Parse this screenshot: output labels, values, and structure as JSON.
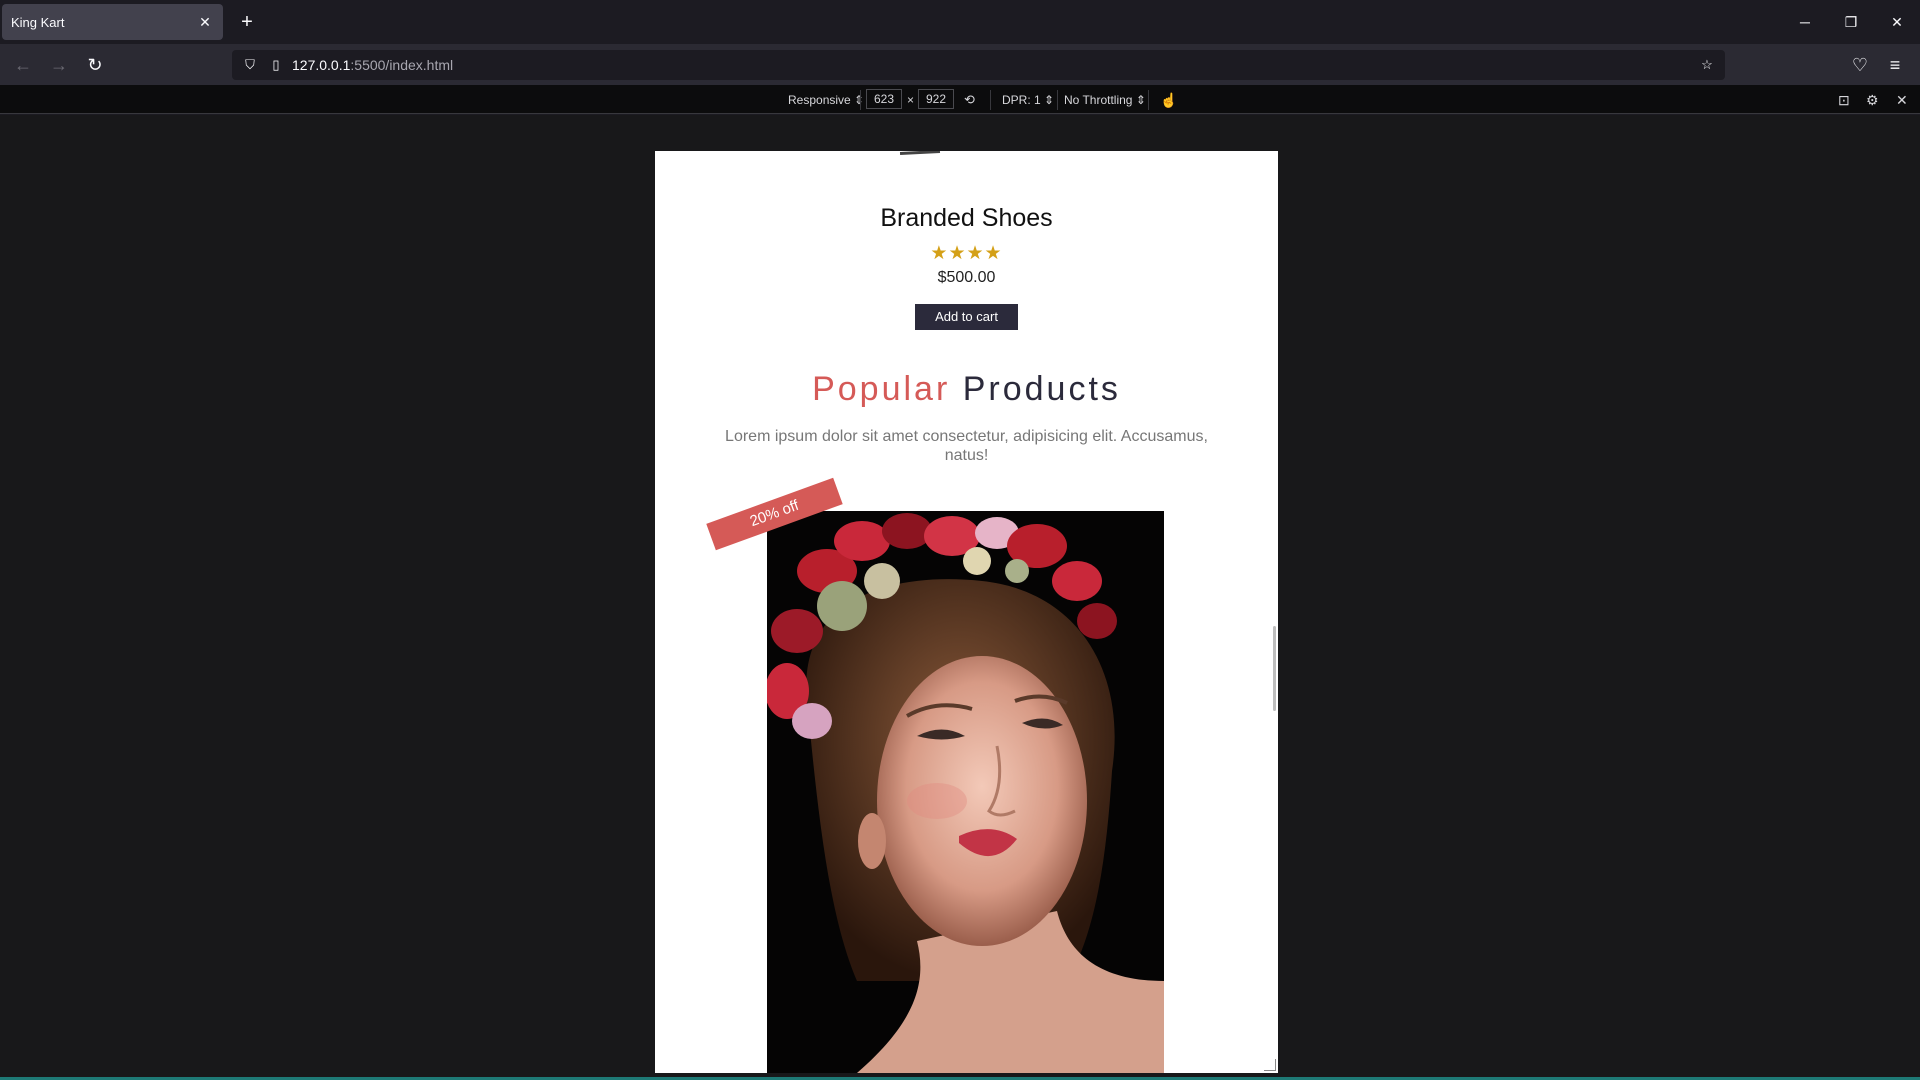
{
  "browser": {
    "tab_title": "King Kart",
    "url_host": "127.0.0.1",
    "url_path": ":5500/index.html"
  },
  "devtools": {
    "device": "Responsive",
    "width": "623",
    "times": "×",
    "height": "922",
    "dpr": "DPR: 1",
    "throttling": "No Throttling"
  },
  "page": {
    "product_title": "Branded Shoes",
    "rating_stars": "★★★★",
    "price": "$500.00",
    "add_to_cart": "Add to cart",
    "section_title_accent": "Popular",
    "section_title_rest": "Products",
    "section_desc": "Lorem ipsum dolor sit amet consectetur, adipisicing elit. Accusamus, natus!",
    "discount_badge": "20% off"
  },
  "colors": {
    "accent": "#d55a57",
    "button": "#2b2a3b",
    "stars": "#d4a017"
  }
}
